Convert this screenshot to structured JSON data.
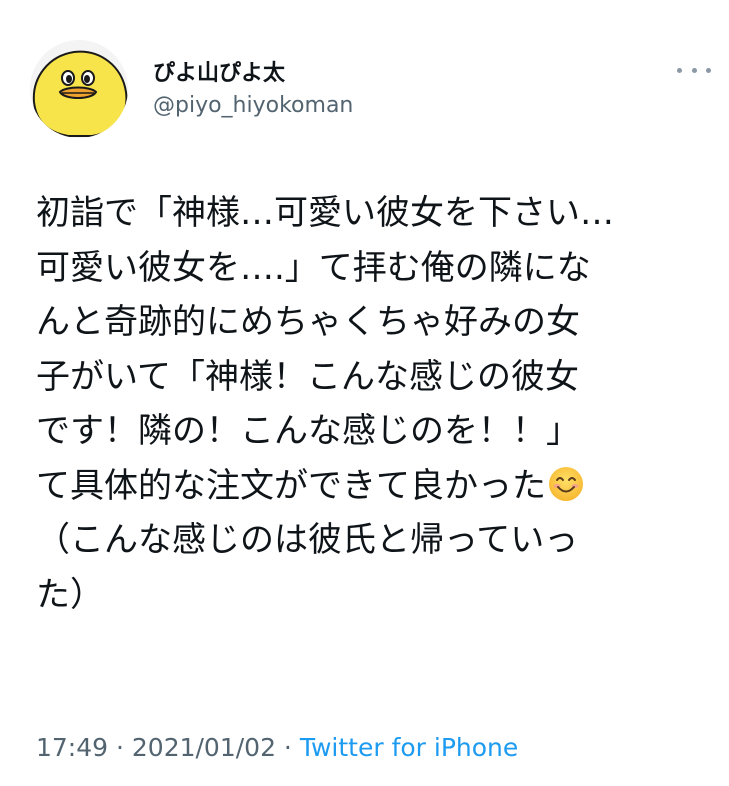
{
  "author": {
    "display_name": "ぴよ山ぴよ太",
    "handle": "@piyo_hiyokoman",
    "avatar_icon": "yellow-chick-face-icon"
  },
  "tweet": {
    "text_lines": [
      "初詣で「神様…可愛い彼女を下さい…",
      "可愛い彼女を….」て拝む俺の隣にな",
      "んと奇跡的にめちゃくちゃ好みの女",
      "子がいて「神様！こんな感じの彼女",
      "です！隣の！こんな感じのを！！」",
      "て具体的な注文ができて良かった",
      "（こんな感じのは彼氏と帰っていっ",
      "た）"
    ],
    "emoji": "smiling-face-with-smiling-eyes-icon"
  },
  "meta": {
    "time": "17:49",
    "separator": " · ",
    "date": "2021/01/02",
    "separator2": " · ",
    "source": "Twitter for iPhone"
  },
  "colors": {
    "text": "#0f1419",
    "secondary": "#536471",
    "link": "#1d9bf0",
    "avatar_yellow": "#f7e34a"
  }
}
